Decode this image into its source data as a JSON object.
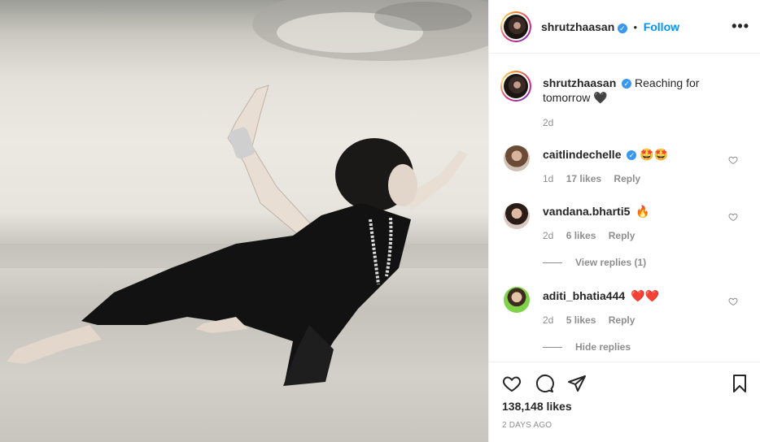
{
  "post": {
    "username": "shrutzhaasan",
    "follow_label": "Follow",
    "separator": "•",
    "more_label": "•••",
    "caption": {
      "username": "shrutzhaasan",
      "text": "Reaching for tomorrow 🖤",
      "age": "2d"
    },
    "comments": [
      {
        "username": "caitlindechelle",
        "verified": true,
        "text": "🤩🤩",
        "age": "1d",
        "likes": "17 likes",
        "reply": "Reply"
      },
      {
        "username": "vandana.bharti5",
        "verified": false,
        "text": "🔥",
        "age": "2d",
        "likes": "6 likes",
        "reply": "Reply",
        "replies_toggle": "View replies (1)"
      },
      {
        "username": "aditi_bhatia444",
        "verified": false,
        "text": "❤️❤️",
        "age": "2d",
        "likes": "5 likes",
        "reply": "Reply",
        "replies_toggle": "Hide replies"
      }
    ],
    "like_count": "138,148 likes",
    "posted": "2 DAYS AGO"
  },
  "icons": {
    "verified": "verified-badge-icon",
    "like": "heart-icon",
    "comment": "comment-bubble-icon",
    "share": "paper-plane-icon",
    "save": "bookmark-icon",
    "more": "ellipsis-icon"
  },
  "colors": {
    "accent": "#0095f6",
    "verified": "#3897f0",
    "muted": "#8e8e8e",
    "text": "#262626"
  }
}
